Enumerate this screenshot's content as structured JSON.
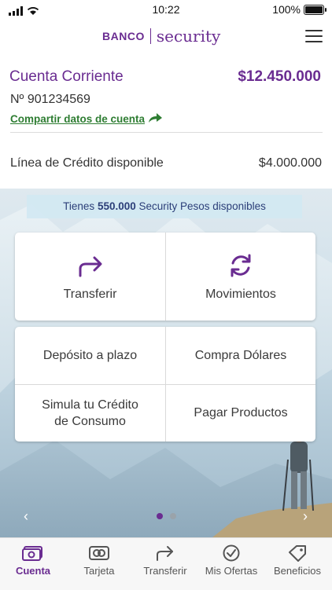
{
  "status_bar": {
    "time": "10:22",
    "battery": "100%"
  },
  "header": {
    "logo_banco": "BANCO",
    "logo_security": "security"
  },
  "account": {
    "name": "Cuenta Corriente",
    "balance": "$12.450.000",
    "number": "Nº 901234569",
    "share_label": "Compartir datos de cuenta",
    "credit_label": "Línea de Crédito disponible",
    "credit_value": "$4.000.000"
  },
  "points_banner": {
    "prefix": "Tienes",
    "amount": "550.000",
    "suffix": "Security Pesos disponibles"
  },
  "quick_actions": {
    "transfer": "Transferir",
    "movements": "Movimientos"
  },
  "more_actions": {
    "deposit": "Depósito a plazo",
    "buy_dollars": "Compra Dólares",
    "credit_sim_line1": "Simula tu Crédito",
    "credit_sim_line2": "de Consumo",
    "pay_products": "Pagar Productos"
  },
  "pager": {
    "total": 2,
    "current": 1
  },
  "tabs": [
    {
      "label": "Cuenta",
      "icon": "cash-icon"
    },
    {
      "label": "Tarjeta",
      "icon": "card-icon"
    },
    {
      "label": "Transferir",
      "icon": "transfer-icon"
    },
    {
      "label": "Mis Ofertas",
      "icon": "check-badge-icon"
    },
    {
      "label": "Beneficios",
      "icon": "tag-icon"
    }
  ],
  "colors": {
    "brand": "#6a2c91",
    "link_green": "#2e7d32",
    "banner_text": "#2b3e78"
  }
}
